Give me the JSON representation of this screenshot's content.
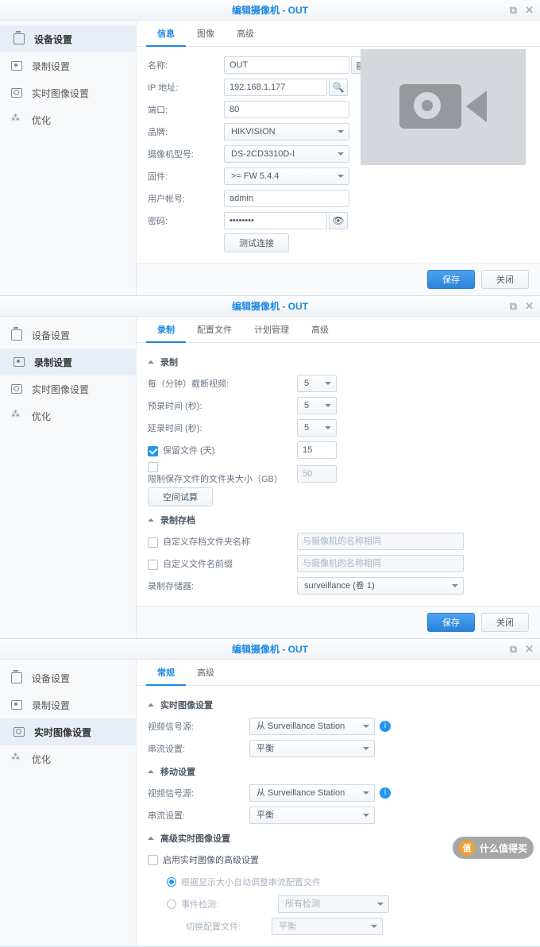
{
  "title": "编辑摄像机 - OUT",
  "controls": {
    "restore": "⧉",
    "close": "✕"
  },
  "sidebar": {
    "items": [
      {
        "label": "设备设置"
      },
      {
        "label": "录制设置"
      },
      {
        "label": "实时图像设置"
      },
      {
        "label": "优化"
      }
    ]
  },
  "panel1": {
    "tabs": [
      "信息",
      "图像",
      "高级"
    ],
    "fields": {
      "name_label": "名称:",
      "name_value": "OUT",
      "ip_label": "IP 地址:",
      "ip_value": "192.168.1.177",
      "port_label": "端口:",
      "port_value": "80",
      "brand_label": "品牌:",
      "brand_value": "HIKVISION",
      "model_label": "摄像机型号:",
      "model_value": "DS-2CD3310D-I",
      "firmware_label": "固件:",
      "firmware_value": ">= FW 5.4.4",
      "user_label": "用户帐号:",
      "user_value": "admin",
      "pass_label": "密码:",
      "pass_value": "••••••••",
      "test_btn": "测试连接"
    }
  },
  "panel2": {
    "tabs": [
      "录制",
      "配置文件",
      "计划管理",
      "高级"
    ],
    "section_rec": "录制",
    "truncate_label": "每（分钟）截断视频:",
    "truncate_value": "5",
    "prerec_label": "预录时间 (秒):",
    "prerec_value": "5",
    "postrec_label": "延录时间 (秒):",
    "postrec_value": "5",
    "keep_label": "保留文件 (天)",
    "keep_value": "15",
    "limit_label": "限制保存文件的文件夹大小（GB）",
    "limit_value": "50",
    "space_btn": "空间试算",
    "section_archive": "录制存档",
    "custom_folder_label": "自定义存档文件夹名称",
    "custom_folder_placeholder": "与摄像机的名称相同",
    "custom_prefix_label": "自定义文件名前缀",
    "custom_prefix_placeholder": "与摄像机的名称相同",
    "storage_label": "录制存储器:",
    "storage_value": "surveillance (卷 1)"
  },
  "panel3": {
    "tabs": [
      "常规",
      "高级"
    ],
    "section_live": "实时图像设置",
    "source_label": "视频信号源:",
    "source_value": "从 Surveillance Station",
    "stream_label": "串流设置:",
    "stream_value": "平衡",
    "section_mobile": "移动设置",
    "section_advanced": "高级实时图像设置",
    "enable_adv_label": "启用实时图像的高级设置",
    "auto_adjust_label": "根据显示大小自动调整串流配置文件",
    "event_detect_label": "事件检测:",
    "event_detect_value": "所有检测",
    "switch_profile_label": "切换配置文件:",
    "switch_profile_value": "平衡"
  },
  "footer": {
    "save": "保存",
    "close": "关闭"
  },
  "watermark": {
    "icon": "值",
    "text": "什么值得买"
  }
}
